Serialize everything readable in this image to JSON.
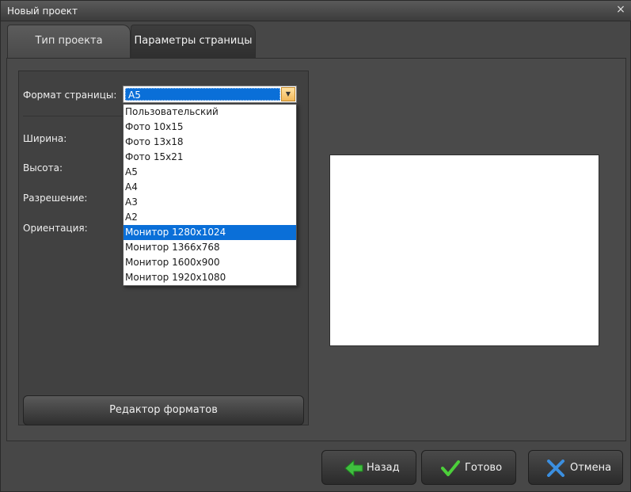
{
  "window": {
    "title": "Новый проект",
    "close_glyph": "×"
  },
  "tabs": [
    {
      "label": "Тип проекта",
      "active": false
    },
    {
      "label": "Параметры страницы",
      "active": true
    }
  ],
  "form": {
    "page_format_label": "Формат страницы:",
    "page_format_value": "A5",
    "width_label": "Ширина:",
    "height_label": "Высота:",
    "resolution_label": "Разрешение:",
    "orientation_label": "Ориентация:",
    "format_options": [
      "Пользовательский",
      "Фото 10x15",
      "Фото 13x18",
      "Фото 15x21",
      "A5",
      "A4",
      "A3",
      "A2",
      "Монитор 1280x1024",
      "Монитор 1366x768",
      "Монитор 1600x900",
      "Монитор 1920x1080"
    ],
    "highlighted_option": "Монитор 1280x1024"
  },
  "buttons": {
    "format_editor": "Редактор форматов",
    "back": "Назад",
    "done": "Готово",
    "cancel": "Отмена"
  },
  "colors": {
    "selection": "#0a6fd8",
    "back_icon": "#3fbf3f",
    "done_icon": "#4ccf3a",
    "cancel_icon": "#3b8fe0"
  },
  "icons": {
    "back": "arrow-left-icon",
    "done": "checkmark-icon",
    "cancel": "x-icon"
  }
}
